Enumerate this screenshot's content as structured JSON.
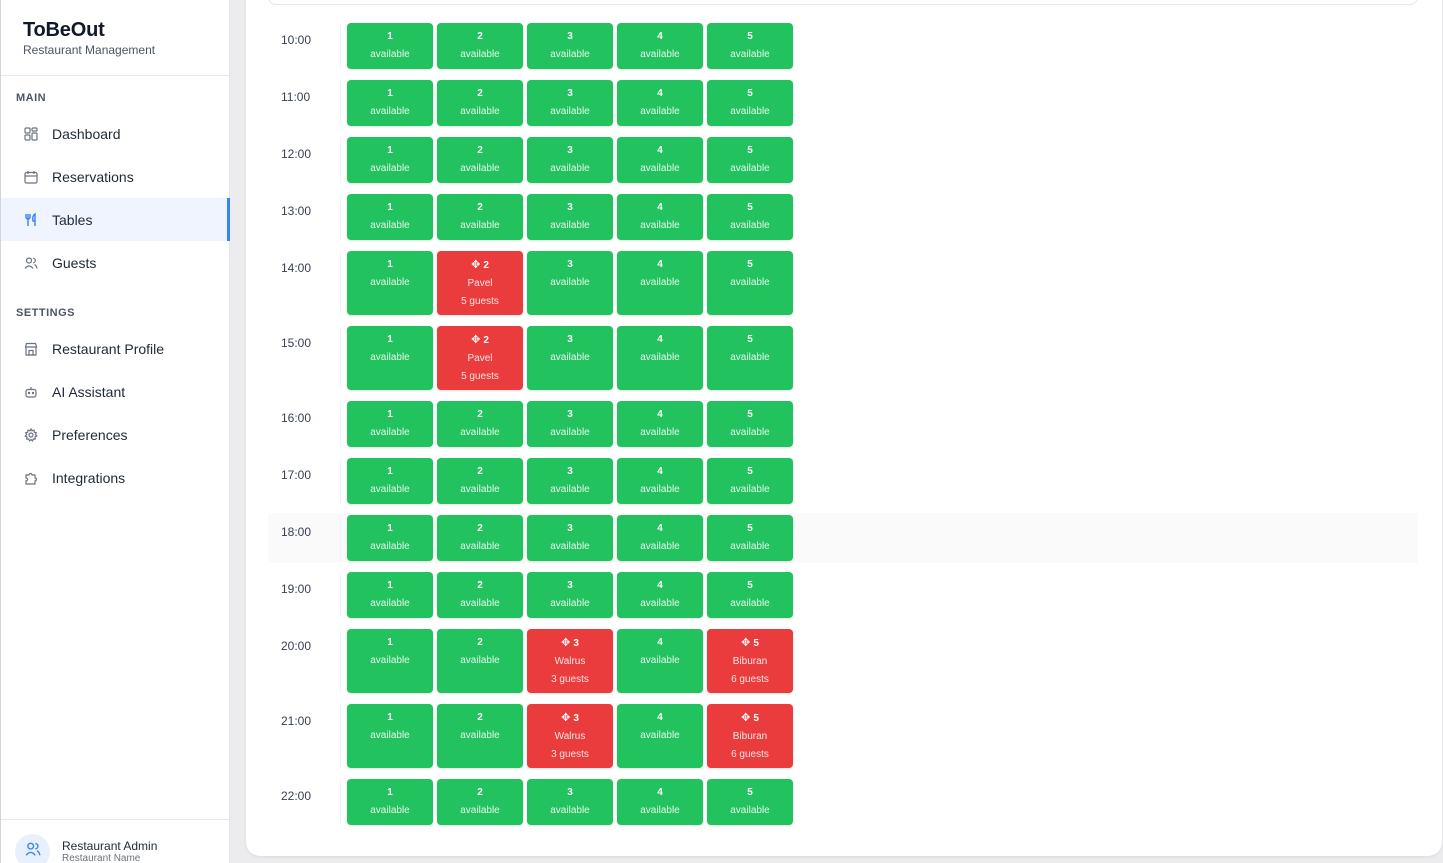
{
  "brand": {
    "title": "ToBeOut",
    "subtitle": "Restaurant Management"
  },
  "sidebar": {
    "main_label": "MAIN",
    "main_items": [
      {
        "label": "Dashboard",
        "icon": "dashboard-icon"
      },
      {
        "label": "Reservations",
        "icon": "calendar-icon"
      },
      {
        "label": "Tables",
        "icon": "utensils-icon",
        "active": true
      },
      {
        "label": "Guests",
        "icon": "users-icon"
      }
    ],
    "settings_label": "SETTINGS",
    "settings_items": [
      {
        "label": "Restaurant Profile",
        "icon": "store-icon"
      },
      {
        "label": "AI Assistant",
        "icon": "bot-icon"
      },
      {
        "label": "Preferences",
        "icon": "gear-icon"
      },
      {
        "label": "Integrations",
        "icon": "puzzle-icon"
      }
    ]
  },
  "user": {
    "name": "Restaurant Admin",
    "subtitle": "Restaurant Name"
  },
  "colors": {
    "available": "#22c35e",
    "booked": "#ea3c3c",
    "accent": "#3b82f6"
  },
  "available_label": "available",
  "schedule": [
    {
      "time": "10:00",
      "booked": {}
    },
    {
      "time": "11:00",
      "booked": {}
    },
    {
      "time": "12:00",
      "booked": {}
    },
    {
      "time": "13:00",
      "booked": {}
    },
    {
      "time": "14:00",
      "booked": {
        "2": {
          "name": "Pavel",
          "guests": "5 guests"
        }
      }
    },
    {
      "time": "15:00",
      "booked": {
        "2": {
          "name": "Pavel",
          "guests": "5 guests"
        }
      }
    },
    {
      "time": "16:00",
      "booked": {}
    },
    {
      "time": "17:00",
      "booked": {}
    },
    {
      "time": "18:00",
      "booked": {},
      "highlight": true
    },
    {
      "time": "19:00",
      "booked": {}
    },
    {
      "time": "20:00",
      "booked": {
        "3": {
          "name": "Walrus",
          "guests": "3 guests"
        },
        "5": {
          "name": "Biburan",
          "guests": "6 guests"
        }
      }
    },
    {
      "time": "21:00",
      "booked": {
        "3": {
          "name": "Walrus",
          "guests": "3 guests"
        },
        "5": {
          "name": "Biburan",
          "guests": "6 guests"
        }
      }
    },
    {
      "time": "22:00",
      "booked": {}
    }
  ],
  "tables": [
    "1",
    "2",
    "3",
    "4",
    "5"
  ]
}
